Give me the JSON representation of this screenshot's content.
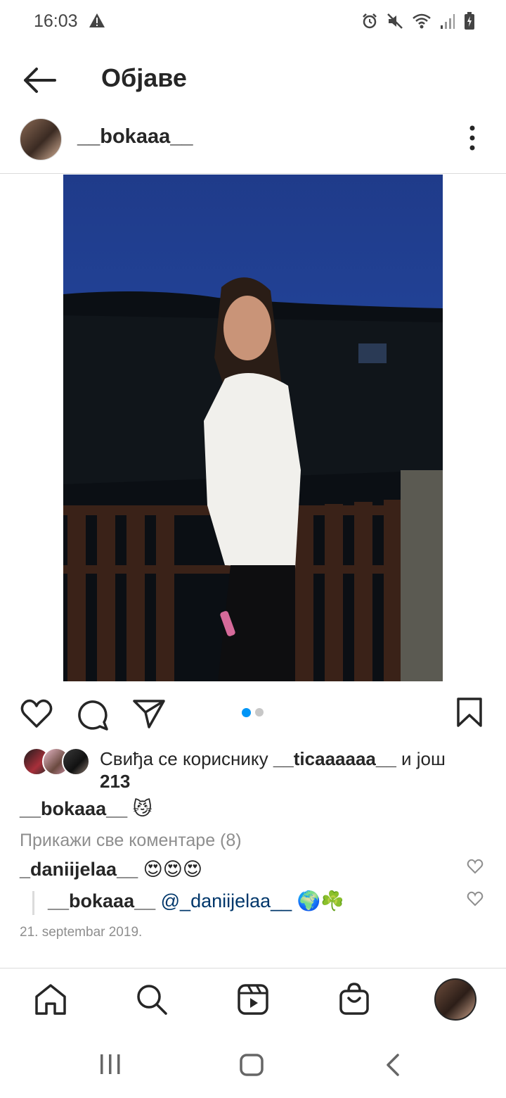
{
  "status_bar": {
    "time": "16:03"
  },
  "header": {
    "title": "Објаве"
  },
  "post": {
    "username": "__bokaaa__",
    "carousel": {
      "count": 2,
      "active_index": 0
    },
    "likes": {
      "prefix": "Свиђа се кориснику",
      "user": "__ticaaaaaa__",
      "connector": "и још",
      "count": "213"
    },
    "caption": {
      "username": "__bokaaa__",
      "text": "😼"
    },
    "view_all_comments": "Прикажи све коментаре (8)",
    "comments": [
      {
        "username": "_daniijelaa__",
        "text": "😍😍😍"
      },
      {
        "username": "__bokaaa__",
        "mention": "@_daniijelaa__",
        "text": "🌍☘️"
      }
    ],
    "date": "21. septembar 2019."
  },
  "bottom_nav": {
    "items": [
      "home-icon",
      "search-icon",
      "reels-icon",
      "shop-icon",
      "profile-avatar"
    ]
  },
  "colors": {
    "accent": "#0095f6",
    "text": "#262626",
    "secondary": "#8e8e8e",
    "mention": "#00376b"
  }
}
